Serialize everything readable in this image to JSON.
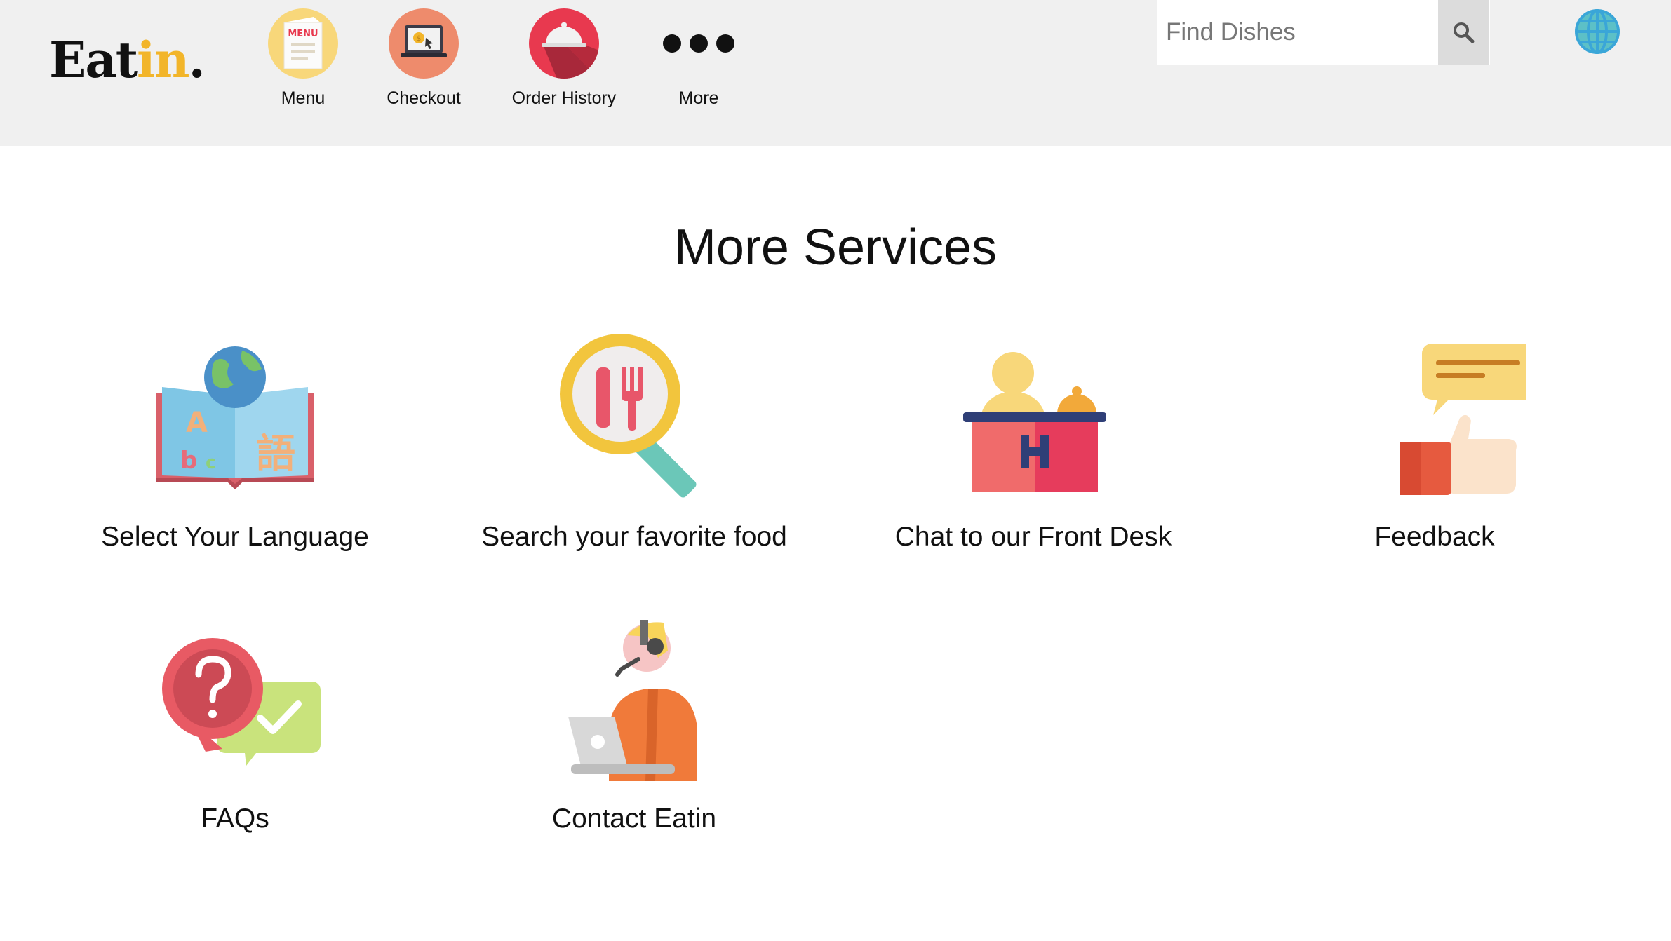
{
  "brand": {
    "part1": "Eat",
    "part2": "in",
    "part3": "."
  },
  "nav": [
    {
      "label": "Menu",
      "icon": "menu-card-icon"
    },
    {
      "label": "Checkout",
      "icon": "checkout-laptop-icon"
    },
    {
      "label": "Order History",
      "icon": "cloche-icon"
    },
    {
      "label": "More",
      "icon": "more-dots-icon"
    }
  ],
  "search": {
    "placeholder": "Find Dishes",
    "value": "",
    "button_icon": "search-icon"
  },
  "language_icon": "globe-icon",
  "page_title": "More Services",
  "services": [
    {
      "label": "Select Your Language",
      "icon": "language-book-icon"
    },
    {
      "label": "Search your favorite food",
      "icon": "food-search-icon"
    },
    {
      "label": "Chat to our Front Desk",
      "icon": "front-desk-icon"
    },
    {
      "label": "Feedback",
      "icon": "feedback-thumbs-up-icon"
    },
    {
      "label": "FAQs",
      "icon": "faq-icon"
    },
    {
      "label": "Contact Eatin",
      "icon": "support-agent-icon"
    }
  ],
  "colors": {
    "header_bg": "#f0f0f0",
    "brand_accent": "#f2b52a",
    "menu_circle": "#f8d77a",
    "checkout_circle": "#ee8b6c",
    "history_circle": "#e8394f"
  }
}
